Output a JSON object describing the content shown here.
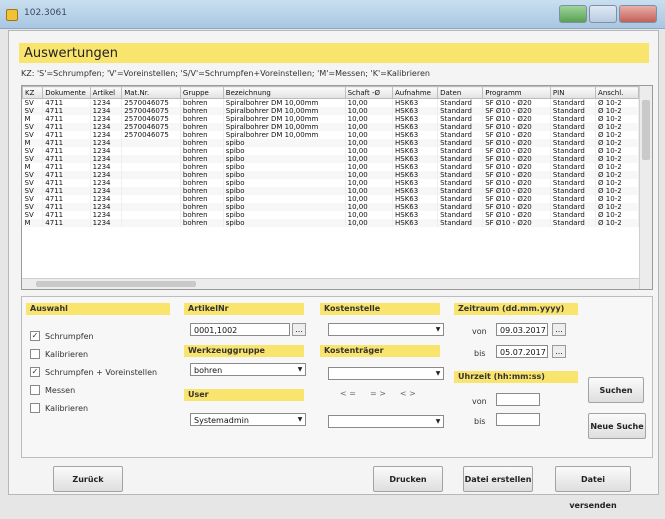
{
  "titlebar": {
    "title": "102.3061"
  },
  "page": {
    "title": "Auswertungen"
  },
  "legend": "KZ: 'S'=Schrumpfen; 'V'=Voreinstellen; 'S/V'=Schrumpfen+Voreinstellen; 'M'=Messen; 'K'=Kalibrieren",
  "table": {
    "columns": [
      "KZ",
      "Dokumente",
      "Artikel",
      "Mat.Nr.",
      "Gruppe",
      "Bezeichnung",
      "Schaft -Ø",
      "Aufnahme",
      "Daten",
      "Programm",
      "PIN",
      "Anschl."
    ],
    "rows": [
      [
        "SV",
        "4711",
        "1234",
        "2570046075",
        "bohren",
        "Spiralbohrer DM 10,00mm",
        "10,00",
        "HSK63",
        "Standard",
        "SF Ø10 - Ø20",
        "Standard",
        "Ø 10-2"
      ],
      [
        "SV",
        "4711",
        "1234",
        "2570046075",
        "bohren",
        "Spiralbohrer DM 10,00mm",
        "10,00",
        "HSK63",
        "Standard",
        "SF Ø10 - Ø20",
        "Standard",
        "Ø 10-2"
      ],
      [
        "M",
        "4711",
        "1234",
        "2570046075",
        "bohren",
        "Spiralbohrer DM 10,00mm",
        "10,00",
        "HSK63",
        "Standard",
        "SF Ø10 - Ø20",
        "Standard",
        "Ø 10-2"
      ],
      [
        "SV",
        "4711",
        "1234",
        "2570046075",
        "bohren",
        "Spiralbohrer DM 10,00mm",
        "10,00",
        "HSK63",
        "Standard",
        "SF Ø10 - Ø20",
        "Standard",
        "Ø 10-2"
      ],
      [
        "SV",
        "4711",
        "1234",
        "2570046075",
        "bohren",
        "Spiralbohrer DM 10,00mm",
        "10,00",
        "HSK63",
        "Standard",
        "SF Ø10 - Ø20",
        "Standard",
        "Ø 10-2"
      ],
      [
        "M",
        "4711",
        "1234",
        "",
        "bohren",
        "spibo",
        "10,00",
        "HSK63",
        "Standard",
        "SF Ø10 - Ø20",
        "Standard",
        "Ø 10-2"
      ],
      [
        "SV",
        "4711",
        "1234",
        "",
        "bohren",
        "spibo",
        "10,00",
        "HSK63",
        "Standard",
        "SF Ø10 - Ø20",
        "Standard",
        "Ø 10-2"
      ],
      [
        "SV",
        "4711",
        "1234",
        "",
        "bohren",
        "spibo",
        "10,00",
        "HSK63",
        "Standard",
        "SF Ø10 - Ø20",
        "Standard",
        "Ø 10-2"
      ],
      [
        "M",
        "4711",
        "1234",
        "",
        "bohren",
        "spibo",
        "10,00",
        "HSK63",
        "Standard",
        "SF Ø10 - Ø20",
        "Standard",
        "Ø 10-2"
      ],
      [
        "SV",
        "4711",
        "1234",
        "",
        "bohren",
        "spibo",
        "10,00",
        "HSK63",
        "Standard",
        "SF Ø10 - Ø20",
        "Standard",
        "Ø 10-2"
      ],
      [
        "SV",
        "4711",
        "1234",
        "",
        "bohren",
        "spibo",
        "10,00",
        "HSK63",
        "Standard",
        "SF Ø10 - Ø20",
        "Standard",
        "Ø 10-2"
      ],
      [
        "SV",
        "4711",
        "1234",
        "",
        "bohren",
        "spibo",
        "10,00",
        "HSK63",
        "Standard",
        "SF Ø10 - Ø20",
        "Standard",
        "Ø 10-2"
      ],
      [
        "SV",
        "4711",
        "1234",
        "",
        "bohren",
        "spibo",
        "10,00",
        "HSK63",
        "Standard",
        "SF Ø10 - Ø20",
        "Standard",
        "Ø 10-2"
      ],
      [
        "SV",
        "4711",
        "1234",
        "",
        "bohren",
        "spibo",
        "10,00",
        "HSK63",
        "Standard",
        "SF Ø10 - Ø20",
        "Standard",
        "Ø 10-2"
      ],
      [
        "SV",
        "4711",
        "1234",
        "",
        "bohren",
        "spibo",
        "10,00",
        "HSK63",
        "Standard",
        "SF Ø10 - Ø20",
        "Standard",
        "Ø 10-2"
      ],
      [
        "M",
        "4711",
        "1234",
        "",
        "bohren",
        "spibo",
        "10,00",
        "HSK63",
        "Standard",
        "SF Ø10 - Ø20",
        "Standard",
        "Ø 10-2"
      ]
    ]
  },
  "filter": {
    "auswahl": {
      "label": "Auswahl",
      "options": [
        {
          "label": "Schrumpfen",
          "checked": "✓"
        },
        {
          "label": "Kalibrieren",
          "checked": ""
        },
        {
          "label": "Schrumpfen + Voreinstellen",
          "checked": "✓"
        },
        {
          "label": "Messen",
          "checked": ""
        },
        {
          "label": "Kalibrieren",
          "checked": ""
        }
      ]
    },
    "artikel": {
      "label": "ArtikelNr",
      "value": "0001,1002",
      "ellipsis": "..."
    },
    "werkzeuggruppe": {
      "label": "Werkzeuggruppe",
      "value": "bohren"
    },
    "user": {
      "label": "User",
      "value": "Systemadmin"
    },
    "kostenstelle": {
      "label": "Kostenstelle",
      "value": ""
    },
    "kostentraeger": {
      "label": "Kostenträger",
      "value": "",
      "radio": [
        "< =",
        "= >",
        "< >"
      ],
      "value2": ""
    },
    "zeitraum": {
      "label": "Zeitraum (dd.mm.yyyy)",
      "von_label": "von",
      "von": "09.03.2017",
      "bis_label": "bis",
      "bis": "05.07.2017",
      "btn": "..."
    },
    "uhrzeit": {
      "label": "Uhrzeit (hh:mm:ss)",
      "von_label": "von",
      "von": "",
      "bis_label": "bis",
      "bis": ""
    },
    "suchen": "Suchen",
    "neue_suche": "Neue Suche"
  },
  "buttons": {
    "zurueck": "Zurück",
    "drucken": "Drucken",
    "datei_erstellen": "Datei erstellen",
    "datei_versenden": "Datei versenden"
  },
  "colors": {
    "accent_yellow": "#f9e46e",
    "window_bg": "#f4f4f4"
  }
}
